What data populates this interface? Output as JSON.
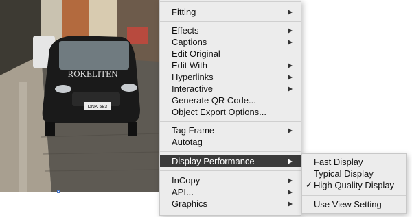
{
  "context_menu": {
    "items": [
      {
        "label": "Fitting",
        "has_submenu": true
      },
      {
        "label": "Effects",
        "has_submenu": true
      },
      {
        "label": "Captions",
        "has_submenu": true
      },
      {
        "label": "Edit Original",
        "has_submenu": false
      },
      {
        "label": "Edit With",
        "has_submenu": true
      },
      {
        "label": "Hyperlinks",
        "has_submenu": true
      },
      {
        "label": "Interactive",
        "has_submenu": true
      },
      {
        "label": "Generate QR Code...",
        "has_submenu": false
      },
      {
        "label": "Object Export Options...",
        "has_submenu": false
      },
      {
        "label": "Tag Frame",
        "has_submenu": true
      },
      {
        "label": "Autotag",
        "has_submenu": false
      },
      {
        "label": "Display Performance",
        "has_submenu": true,
        "highlighted": true
      },
      {
        "label": "InCopy",
        "has_submenu": true
      },
      {
        "label": "API...",
        "has_submenu": true
      },
      {
        "label": "Graphics",
        "has_submenu": true
      }
    ]
  },
  "display_performance_submenu": {
    "items": [
      {
        "label": "Fast Display",
        "checked": false
      },
      {
        "label": "Typical Display",
        "checked": false
      },
      {
        "label": "High Quality Display",
        "checked": true
      },
      {
        "label": "Use View Setting",
        "checked": false
      }
    ],
    "check_glyph": "✓"
  },
  "photo": {
    "van_text": "ROKELITEN",
    "plate_text": "DNK 583"
  },
  "colors": {
    "highlight": "#3a3a3a",
    "menu_bg": "#ececec",
    "frame_selection": "#4a78c8"
  }
}
